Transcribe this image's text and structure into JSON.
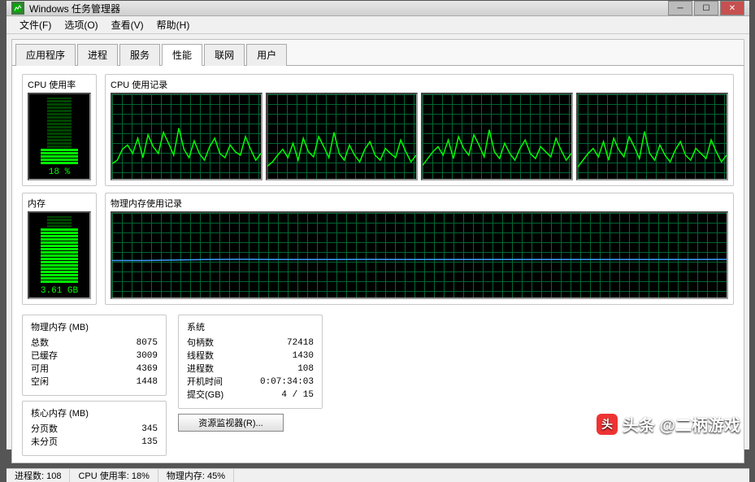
{
  "window": {
    "title": "Windows 任务管理器"
  },
  "menu": {
    "file": "文件(F)",
    "options": "选项(O)",
    "view": "查看(V)",
    "help": "帮助(H)"
  },
  "tabs": {
    "apps": "应用程序",
    "processes": "进程",
    "services": "服务",
    "performance": "性能",
    "networking": "联网",
    "users": "用户"
  },
  "labels": {
    "cpu_usage": "CPU 使用率",
    "cpu_history": "CPU 使用记录",
    "memory": "内存",
    "mem_history": "物理内存使用记录"
  },
  "cpu_meter": {
    "text": "18 %",
    "percent": 18
  },
  "mem_meter": {
    "text": "3.61 GB",
    "percent": 45
  },
  "phys_mem": {
    "title": "物理内存 (MB)",
    "total_k": "总数",
    "total_v": "8075",
    "cached_k": "已缓存",
    "cached_v": "3009",
    "avail_k": "可用",
    "avail_v": "4369",
    "free_k": "空闲",
    "free_v": "1448"
  },
  "kernel_mem": {
    "title": "核心内存 (MB)",
    "paged_k": "分页数",
    "paged_v": "345",
    "nonpaged_k": "未分页",
    "nonpaged_v": "135"
  },
  "system": {
    "title": "系统",
    "handles_k": "句柄数",
    "handles_v": "72418",
    "threads_k": "线程数",
    "threads_v": "1430",
    "processes_k": "进程数",
    "processes_v": "108",
    "uptime_k": "开机时间",
    "uptime_v": "0:07:34:03",
    "commit_k": "提交(GB)",
    "commit_v": "4 / 15"
  },
  "resmon_button": "资源监视器(R)...",
  "status": {
    "processes": "进程数: 108",
    "cpu": "CPU 使用率: 18%",
    "mem": "物理内存: 45%"
  },
  "watermark": "头条 @二柄游戏",
  "chart_data": {
    "type": "line",
    "cpu_cores": [
      {
        "name": "core0",
        "values": [
          18,
          22,
          35,
          40,
          30,
          48,
          25,
          52,
          38,
          30,
          55,
          42,
          28,
          60,
          35,
          25,
          45,
          30,
          22,
          38,
          48,
          30,
          25,
          40,
          32,
          28,
          50,
          35,
          22,
          30
        ]
      },
      {
        "name": "core1",
        "values": [
          15,
          20,
          28,
          35,
          25,
          42,
          22,
          48,
          32,
          26,
          50,
          38,
          25,
          55,
          30,
          22,
          40,
          28,
          20,
          35,
          44,
          28,
          22,
          36,
          30,
          25,
          46,
          32,
          20,
          28
        ]
      },
      {
        "name": "core2",
        "values": [
          16,
          24,
          32,
          38,
          28,
          46,
          24,
          50,
          36,
          28,
          52,
          40,
          26,
          58,
          32,
          24,
          42,
          30,
          22,
          36,
          46,
          30,
          24,
          38,
          32,
          26,
          48,
          34,
          22,
          30
        ]
      },
      {
        "name": "core3",
        "values": [
          14,
          22,
          30,
          36,
          26,
          44,
          22,
          48,
          34,
          26,
          50,
          38,
          24,
          56,
          30,
          22,
          40,
          28,
          20,
          34,
          44,
          28,
          22,
          36,
          30,
          24,
          46,
          32,
          20,
          28
        ]
      }
    ],
    "cpu_ylim": [
      0,
      100
    ],
    "memory": {
      "name": "physical_memory_gb",
      "values": [
        3.5,
        3.5,
        3.55,
        3.6,
        3.62,
        3.6,
        3.6,
        3.6,
        3.61,
        3.6,
        3.6,
        3.6,
        3.6,
        3.6,
        3.6,
        3.6,
        3.6,
        3.6,
        3.6,
        3.61
      ],
      "ylim": [
        0,
        8
      ]
    }
  }
}
